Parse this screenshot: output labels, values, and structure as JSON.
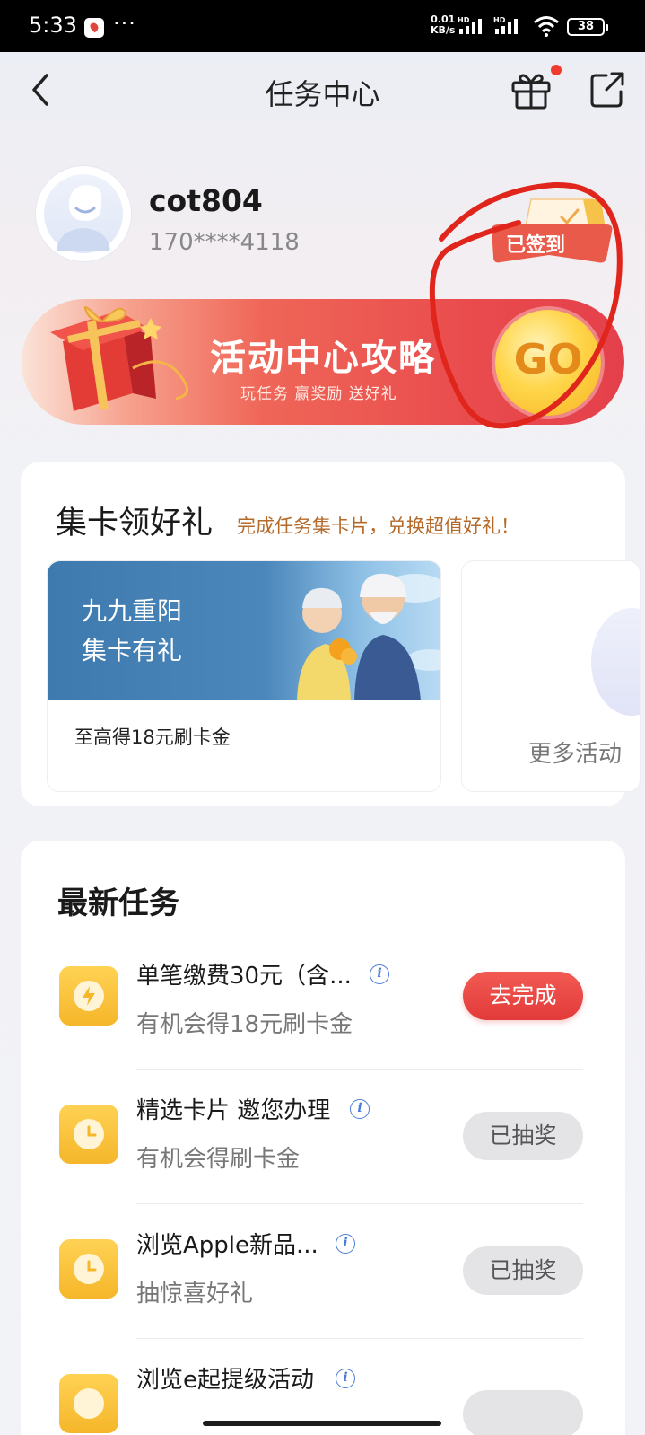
{
  "status_bar": {
    "time": "5:33",
    "dots": "···",
    "net_speed_value": "0.01",
    "net_speed_unit": "KB/s",
    "signal_label": "HD",
    "battery": "38"
  },
  "header": {
    "title": "任务中心",
    "back_icon": "chevron-left-icon",
    "gift_icon": "gift-icon",
    "share_icon": "share-icon",
    "gift_has_notification": true
  },
  "user": {
    "name": "cot804",
    "phone": "170****4118",
    "signed_badge": "已签到"
  },
  "banner": {
    "title": "活动中心攻略",
    "subtitle": "玩任务 赢奖励 送好礼",
    "go_label": "GO"
  },
  "card_section": {
    "title": "集卡领好礼",
    "subtitle": "完成任务集卡片，兑换超值好礼！",
    "promo": {
      "line1": "九九重阳",
      "line2": "集卡有礼",
      "desc": "至高得18元刷卡金"
    },
    "more_label": "更多活动"
  },
  "task_section": {
    "title": "最新任务",
    "tasks": [
      {
        "name": "单笔缴费30元（含...",
        "sub": "有机会得18元刷卡金",
        "action": "去完成",
        "state": "active",
        "icon": "bolt-icon"
      },
      {
        "name": "精选卡片 邀您办理",
        "sub": "有机会得刷卡金",
        "action": "已抽奖",
        "state": "done",
        "icon": "clock-icon"
      },
      {
        "name": "浏览Apple新品...",
        "sub": "抽惊喜好礼",
        "action": "已抽奖",
        "state": "done",
        "icon": "clock-icon"
      },
      {
        "name": "浏览e起提级活动",
        "sub": "",
        "action": "",
        "state": "done",
        "icon": "clock-icon"
      }
    ]
  },
  "colors": {
    "accent_red": "#e23a3a",
    "task_icon_yellow": "#f5b62a",
    "subtitle_brown": "#b46a2a",
    "annotation_red": "#e0251c"
  }
}
